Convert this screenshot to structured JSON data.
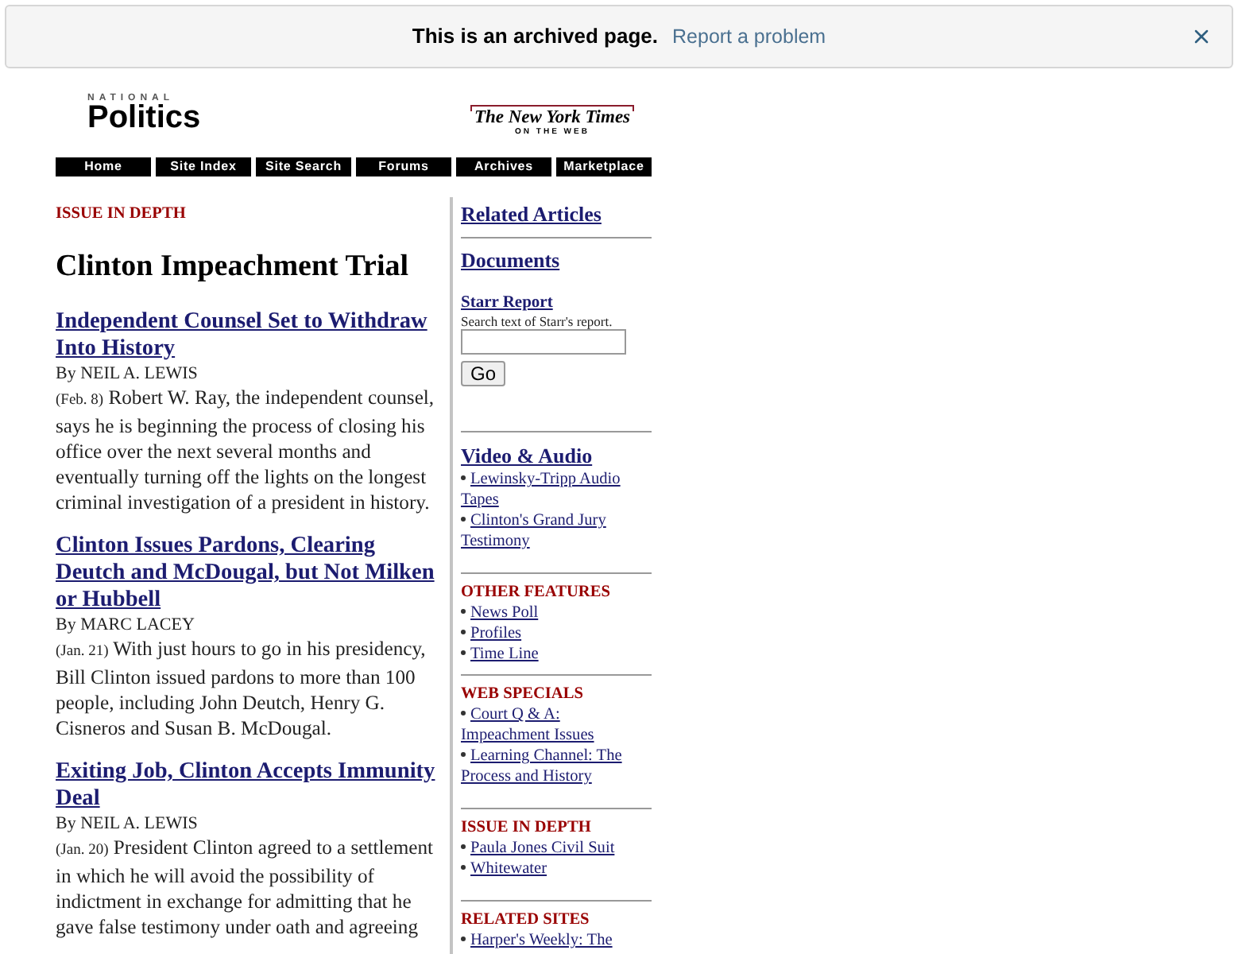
{
  "archive_banner": {
    "message": "This is an archived page.",
    "link": "Report a problem"
  },
  "header": {
    "logo": {
      "kicker": "NATIONAL",
      "title": "Politics"
    },
    "partner_logo": {
      "wordmark": "The New York Times",
      "tagline": "ON THE WEB"
    }
  },
  "nav": [
    "Home",
    "Site Index",
    "Site Search",
    "Forums",
    "Archives",
    "Marketplace"
  ],
  "main": {
    "section_label": "ISSUE IN DEPTH",
    "title": "Clinton Impeachment Trial",
    "articles": [
      {
        "headline": "Independent Counsel Set to Withdraw Into History",
        "byline": "By NEIL A. LEWIS",
        "date": "(Feb. 8)",
        "summary": "Robert W. Ray, the independent counsel, says he is beginning the process of closing his office over the next several months and eventually turning off the lights on the longest criminal investigation of a president in history."
      },
      {
        "headline": "Clinton Issues Pardons, Clearing Deutch and McDougal, but Not Milken or Hubbell",
        "byline": "By MARC LACEY",
        "date": "(Jan. 21)",
        "summary": "With just hours to go in his presidency, Bill Clinton issued pardons to more than 100 people, including John Deutch, Henry G. Cisneros and Susan B. McDougal."
      },
      {
        "headline": "Exiting Job, Clinton Accepts Immunity Deal",
        "byline": "By NEIL A. LEWIS",
        "date": "(Jan. 20)",
        "summary": "President Clinton agreed to a settlement in which he will avoid the possibility of indictment in exchange for admitting that he gave false testimony under oath and agreeing"
      }
    ]
  },
  "sidebar": {
    "blocks": [
      {
        "kind": "heading",
        "title": "Related Articles"
      },
      {
        "kind": "search",
        "title": "Documents",
        "search": {
          "label": "Starr Report",
          "hint": "Search text of Starr's report.",
          "button": "Go"
        }
      },
      {
        "kind": "media",
        "title": "Video & Audio",
        "links": [
          "Lewinsky-Tripp Audio Tapes",
          "Clinton's Grand Jury Testimony"
        ]
      },
      {
        "kind": "category",
        "title": "OTHER FEATURES",
        "links": [
          "News Poll",
          "Profiles",
          "Time Line"
        ]
      },
      {
        "kind": "category",
        "title": "WEB SPECIALS",
        "links": [
          "Court Q & A: Impeachment Issues",
          "Learning Channel: The Process and History"
        ]
      },
      {
        "kind": "category",
        "title": "ISSUE IN DEPTH",
        "links": [
          "Paula Jones Civil Suit",
          "Whitewater"
        ]
      },
      {
        "kind": "category",
        "title": "RELATED SITES",
        "links": [
          "Harper's Weekly: The"
        ]
      }
    ]
  }
}
